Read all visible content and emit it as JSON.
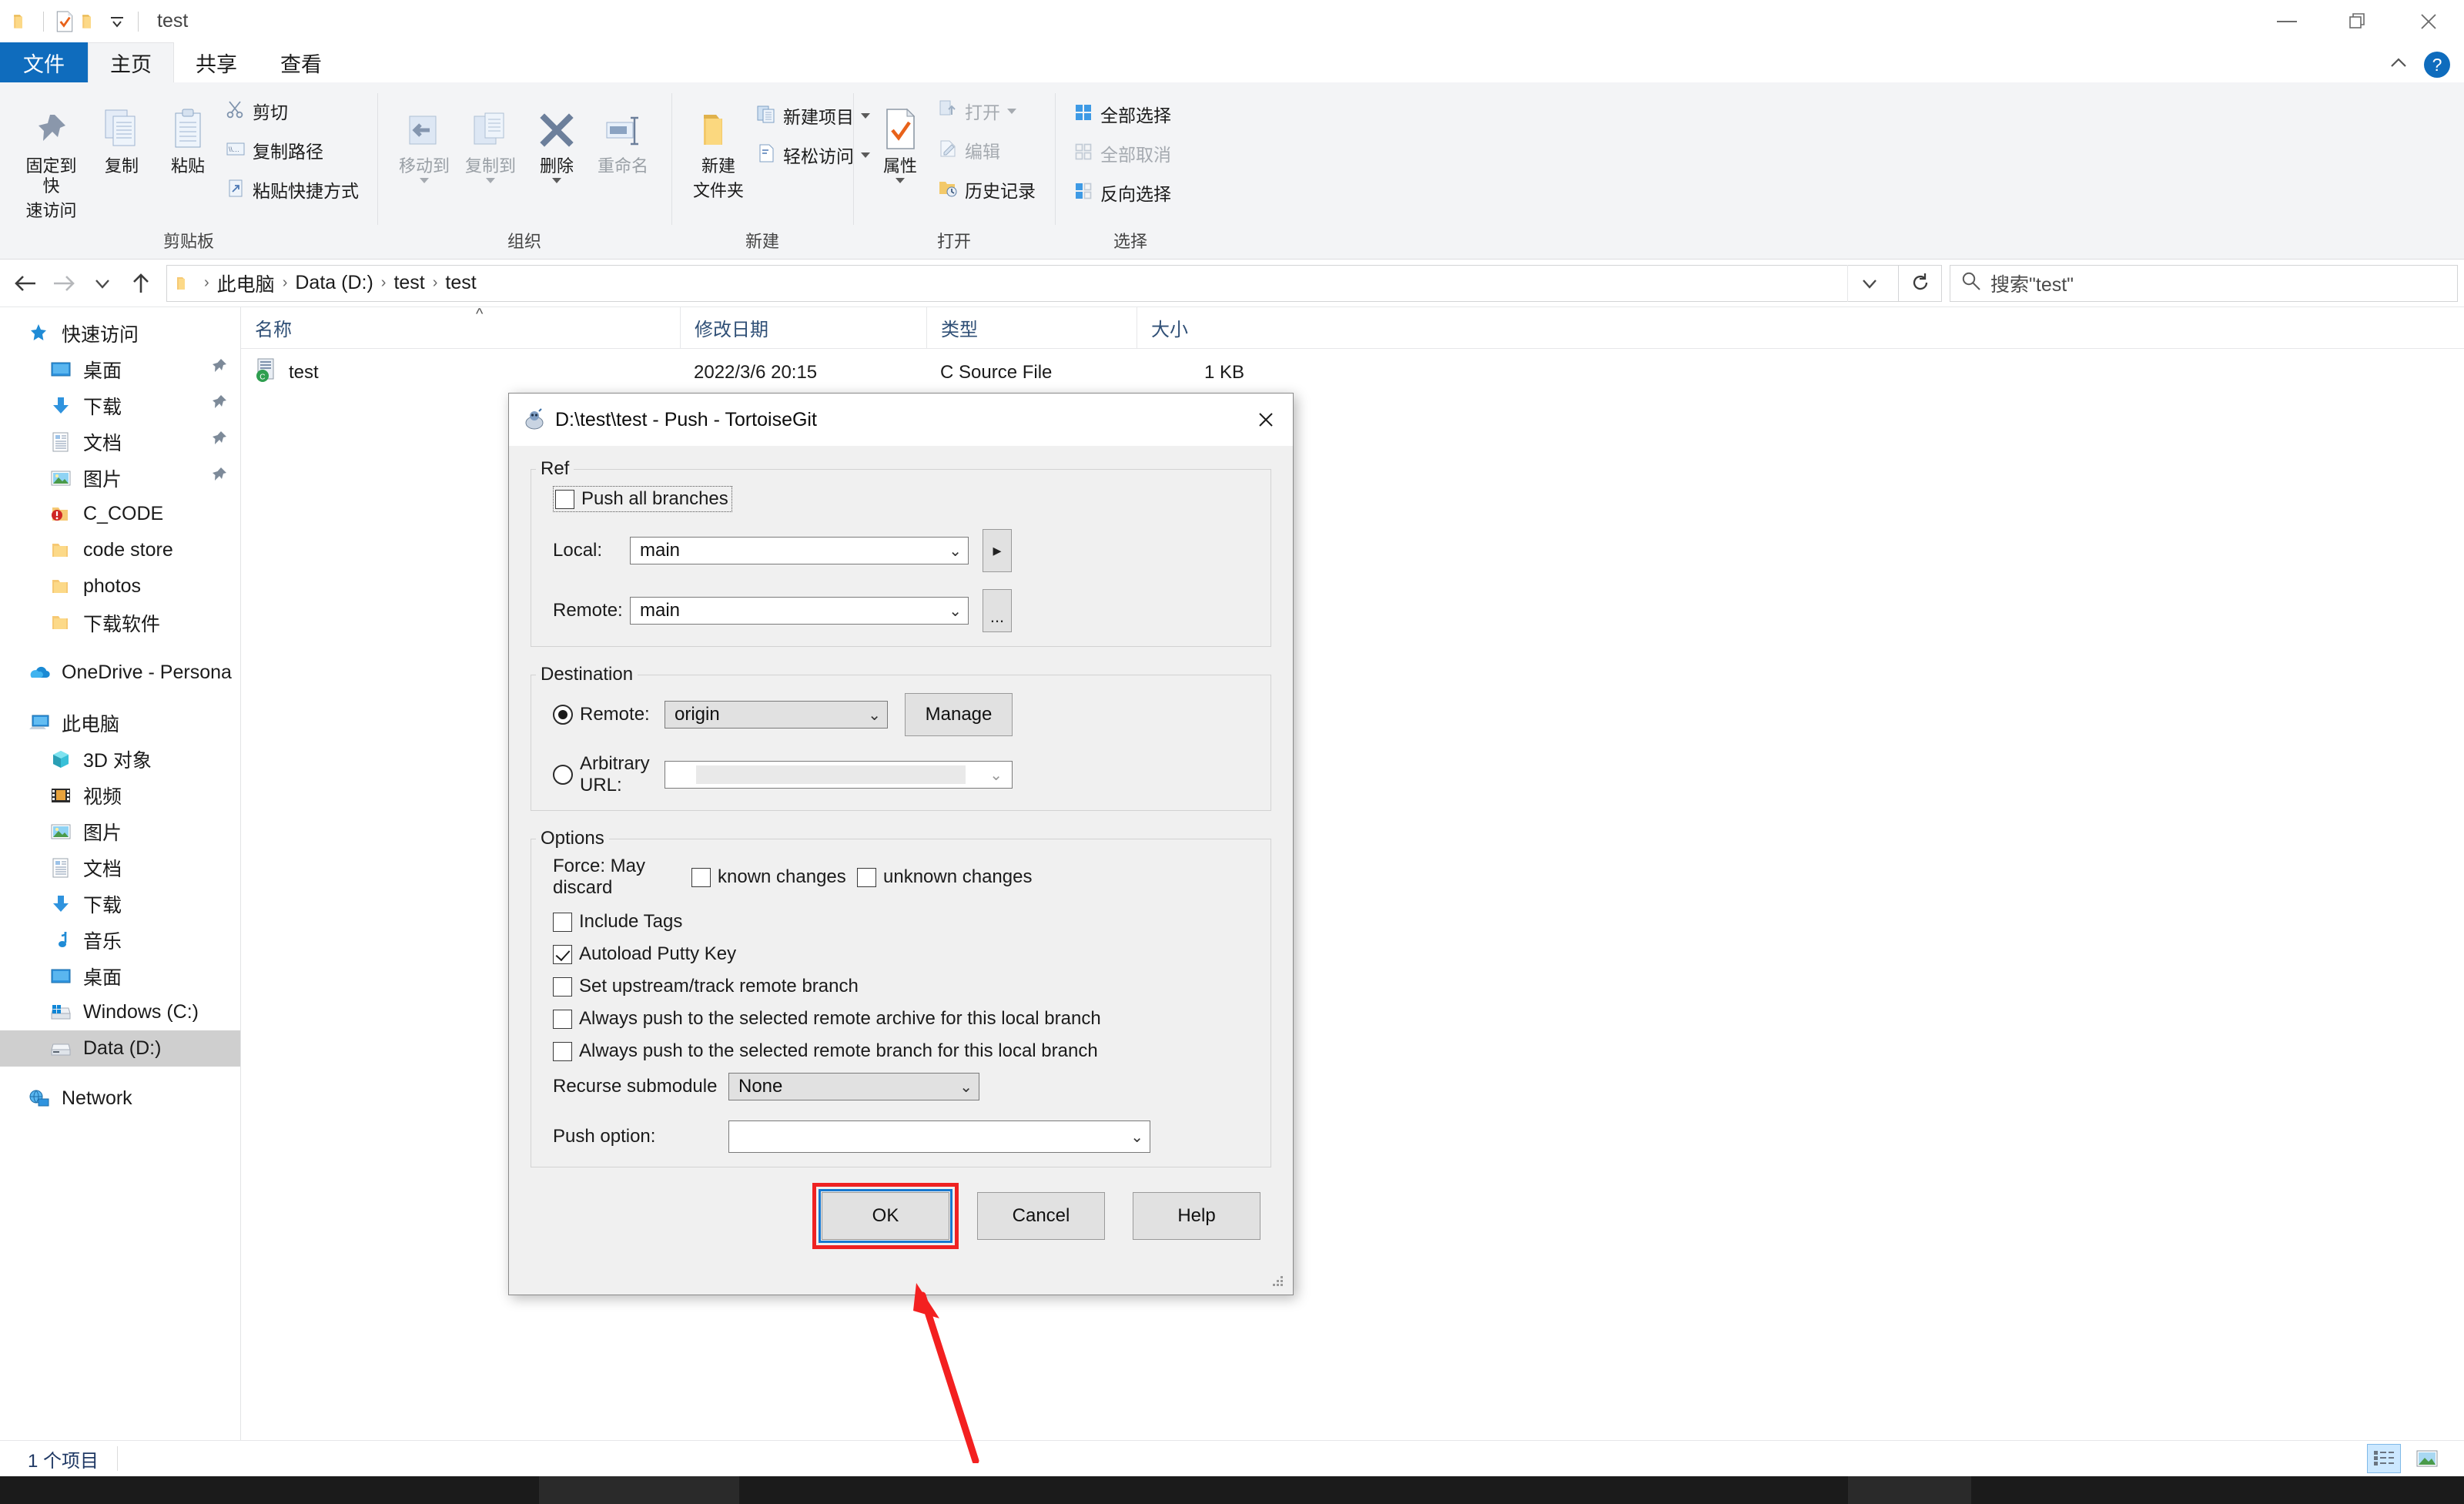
{
  "window": {
    "title": "test",
    "quick_access": [
      "folder-icon",
      "checkmark-doc-icon",
      "folder-icon",
      "customize-dropdown-icon"
    ],
    "controls": {
      "minimize": "—",
      "restore": "❐",
      "close": "✕",
      "collapse_ribbon": "^",
      "help": "?"
    }
  },
  "ribbon": {
    "tabs": [
      {
        "id": "file",
        "label": "文件"
      },
      {
        "id": "home",
        "label": "主页"
      },
      {
        "id": "share",
        "label": "共享"
      },
      {
        "id": "view",
        "label": "查看"
      }
    ],
    "groups": [
      {
        "label": "剪贴板",
        "big": [
          {
            "label": "固定到快\n速访问",
            "label_l1": "固定到快",
            "label_l2": "速访问",
            "icon": "pin-icon"
          },
          {
            "label": "复制",
            "icon": "copy-icon"
          },
          {
            "label": "粘贴",
            "icon": "paste-icon"
          }
        ],
        "small": [
          {
            "label": "剪切",
            "icon": "scissors-icon"
          },
          {
            "label": "复制路径",
            "icon": "copy-path-icon"
          },
          {
            "label": "粘贴快捷方式",
            "icon": "paste-shortcut-icon"
          }
        ]
      },
      {
        "label": "组织",
        "big": [
          {
            "label": "移动到",
            "icon": "move-to-icon",
            "dropdown": true,
            "dim": true
          },
          {
            "label": "复制到",
            "icon": "copy-to-icon",
            "dropdown": true,
            "dim": true
          },
          {
            "label": "删除",
            "icon": "delete-icon",
            "dropdown": true
          },
          {
            "label": "重命名",
            "icon": "rename-icon",
            "dim": true
          }
        ],
        "small": []
      },
      {
        "label": "新建",
        "big": [
          {
            "label_l1": "新建",
            "label_l2": "文件夹",
            "icon": "new-folder-icon"
          }
        ],
        "small": [
          {
            "label": "新建项目",
            "icon": "new-item-icon",
            "dropdown": true
          },
          {
            "label": "轻松访问",
            "icon": "easy-access-icon",
            "dropdown": true
          }
        ]
      },
      {
        "label": "打开",
        "big": [
          {
            "label": "属性",
            "icon": "properties-icon",
            "dropdown": true
          }
        ],
        "small": [
          {
            "label": "打开",
            "icon": "open-icon",
            "dropdown": true,
            "dim": true
          },
          {
            "label": "编辑",
            "icon": "edit-icon",
            "dim": true
          },
          {
            "label": "历史记录",
            "icon": "history-icon"
          }
        ]
      },
      {
        "label": "选择",
        "big": [],
        "small": [
          {
            "label": "全部选择",
            "icon": "select-all-icon"
          },
          {
            "label": "全部取消",
            "icon": "select-none-icon",
            "dim": true
          },
          {
            "label": "反向选择",
            "icon": "invert-selection-icon"
          }
        ]
      }
    ]
  },
  "address": {
    "back": "back-arrow-icon",
    "forward": "forward-arrow-icon",
    "recent": "chevron-down-icon",
    "up": "up-arrow-icon",
    "breadcrumbs": [
      "此电脑",
      "Data (D:)",
      "test",
      "test"
    ],
    "dropdown": "chevron-down-icon",
    "refresh": "refresh-icon",
    "search_placeholder": "搜索\"test\""
  },
  "navpane": {
    "sections": [
      {
        "header": {
          "label": "快速访问",
          "icon": "star-pin-icon"
        },
        "items": [
          {
            "label": "桌面",
            "icon": "desktop-icon",
            "pinned": true
          },
          {
            "label": "下载",
            "icon": "downloads-icon",
            "pinned": true
          },
          {
            "label": "文档",
            "icon": "documents-icon",
            "pinned": true
          },
          {
            "label": "图片",
            "icon": "pictures-icon",
            "pinned": true
          },
          {
            "label": "C_CODE",
            "icon": "folder-alert-icon",
            "pinned": false
          },
          {
            "label": "code store",
            "icon": "folder-icon",
            "pinned": false
          },
          {
            "label": "photos",
            "icon": "folder-icon",
            "pinned": false
          },
          {
            "label": "下载软件",
            "icon": "folder-icon",
            "pinned": false
          }
        ]
      },
      {
        "header": {
          "label": "OneDrive - Persona",
          "icon": "onedrive-icon"
        },
        "items": []
      },
      {
        "header": {
          "label": "此电脑",
          "icon": "this-pc-icon"
        },
        "items": [
          {
            "label": "3D 对象",
            "icon": "3d-objects-icon"
          },
          {
            "label": "视频",
            "icon": "videos-icon"
          },
          {
            "label": "图片",
            "icon": "pictures-icon"
          },
          {
            "label": "文档",
            "icon": "documents-icon"
          },
          {
            "label": "下载",
            "icon": "downloads-icon"
          },
          {
            "label": "音乐",
            "icon": "music-icon"
          },
          {
            "label": "桌面",
            "icon": "desktop-icon"
          },
          {
            "label": "Windows (C:)",
            "icon": "drive-windows-icon"
          },
          {
            "label": "Data (D:)",
            "icon": "drive-icon",
            "selected": true
          }
        ]
      },
      {
        "header": {
          "label": "Network",
          "icon": "network-icon"
        },
        "items": []
      }
    ]
  },
  "filelist": {
    "columns": [
      "名称",
      "修改日期",
      "类型",
      "大小"
    ],
    "rows": [
      {
        "name": "test",
        "icon": "c-source-file-icon",
        "modified": "2022/3/6 20:15",
        "type": "C Source File",
        "size": "1 KB"
      }
    ]
  },
  "statusbar": {
    "count": "1 个项目",
    "view_buttons": [
      "details-view-icon",
      "large-icons-view-icon"
    ]
  },
  "dialog": {
    "title": "D:\\test\\test - Push - TortoiseGit",
    "icon": "tortoisegit-icon",
    "close": "✕",
    "ref": {
      "legend": "Ref",
      "push_all_branches": {
        "label": "Push all branches",
        "checked": false,
        "focused": true
      },
      "local": {
        "label": "Local:",
        "value": "main",
        "browse_button": "▸"
      },
      "remote": {
        "label": "Remote:",
        "value": "main",
        "browse_button": "..."
      }
    },
    "destination": {
      "legend": "Destination",
      "mode": "remote",
      "remote": {
        "label": "Remote:",
        "value": "origin",
        "selected": true
      },
      "manage_button": "Manage",
      "arbitrary_url": {
        "label": "Arbitrary URL:",
        "value": "",
        "selected": false
      }
    },
    "options": {
      "legend": "Options",
      "force_label": "Force: May discard",
      "force_known": {
        "label": "known changes",
        "checked": false
      },
      "force_unknown": {
        "label": "unknown changes",
        "checked": false
      },
      "checkboxes": [
        {
          "label": "Include Tags",
          "checked": false
        },
        {
          "label": "Autoload Putty Key",
          "checked": true
        },
        {
          "label": "Set upstream/track remote branch",
          "checked": false
        },
        {
          "label": "Always push to the selected remote archive for this local branch",
          "checked": false
        },
        {
          "label": "Always push to the selected remote branch for this local branch",
          "checked": false
        }
      ],
      "recurse_submodule": {
        "label": "Recurse submodule",
        "value": "None"
      },
      "push_option": {
        "label": "Push option:",
        "value": ""
      }
    },
    "buttons": {
      "ok": {
        "label": "OK",
        "highlighted": true,
        "focused": true
      },
      "cancel": {
        "label": "Cancel"
      },
      "help": {
        "label": "Help"
      }
    }
  },
  "annotation": {
    "arrow_color": "#f32020",
    "points_to": "ok-button"
  }
}
